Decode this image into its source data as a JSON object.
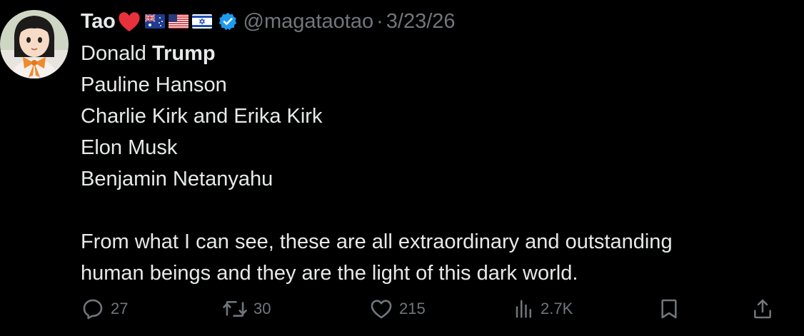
{
  "tweet": {
    "display_name": "Tao",
    "handle": "@magataotao",
    "separator": "·",
    "date": "3/23/26",
    "lines": [
      {
        "regular": "Donald ",
        "bold": "Trump"
      },
      {
        "text": "Pauline Hanson"
      },
      {
        "text": "Charlie Kirk and Erika Kirk"
      },
      {
        "text": "Elon Musk"
      },
      {
        "text": "Benjamin Netanyahu"
      }
    ],
    "paragraph_lines": [
      "From what I can see, these are all extraordinary and outstanding",
      "human beings and they are the light of this dark world."
    ]
  },
  "actions": {
    "replies": "27",
    "reposts": "30",
    "likes": "215",
    "views": "2.7K"
  },
  "icons": {
    "reply": "reply-icon",
    "repost": "repost-icon",
    "like": "like-icon",
    "views": "views-icon",
    "bookmark": "bookmark-icon",
    "share": "share-icon",
    "verified": "verified-badge-icon"
  },
  "colors": {
    "background": "#000000",
    "text": "#e7e9ea",
    "muted": "#71767b",
    "verified": "#1d9bf0",
    "heart": "#f91880"
  }
}
